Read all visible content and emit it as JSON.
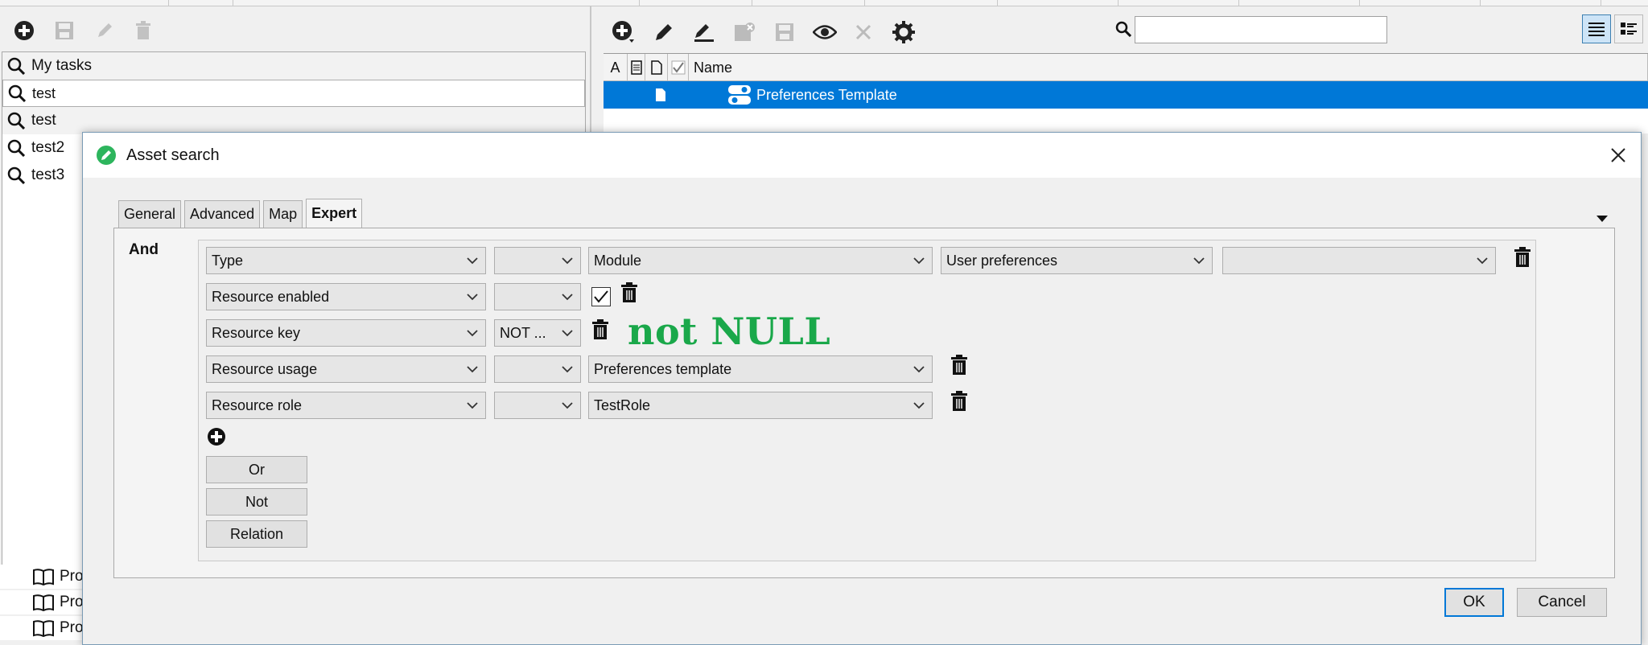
{
  "left_panel": {
    "items": [
      {
        "label": "My tasks"
      },
      {
        "label": "test"
      },
      {
        "label": "test"
      },
      {
        "label": "test2"
      },
      {
        "label": "test3"
      }
    ],
    "bottom_items": [
      {
        "label": "Pro"
      },
      {
        "label": "Pro"
      },
      {
        "label": "Pro"
      }
    ]
  },
  "right_panel": {
    "search_placeholder": "",
    "columns": [
      "A",
      "",
      "",
      "",
      "Name"
    ],
    "rows": [
      {
        "name": "Preferences Template"
      }
    ]
  },
  "dialog": {
    "title": "Asset search",
    "tabs": [
      "General",
      "Advanced",
      "Map",
      "Expert"
    ],
    "active_tab": "Expert",
    "operator_label": "And",
    "conditions": [
      {
        "field": "Type",
        "operator": "",
        "value1": "Module",
        "value2": "User preferences",
        "value3": ""
      },
      {
        "field": "Resource enabled",
        "operator": "",
        "checked": true
      },
      {
        "field": "Resource key",
        "operator": "NOT ..."
      },
      {
        "field": "Resource usage",
        "operator": "",
        "value1": "Preferences template"
      },
      {
        "field": "Resource role",
        "operator": "",
        "value1": "TestRole"
      }
    ],
    "buttons": {
      "or": "Or",
      "not": "Not",
      "relation": "Relation"
    },
    "ok": "OK",
    "cancel": "Cancel"
  },
  "annotation": "not NULL",
  "colors": {
    "selection": "#0078d7",
    "annotation": "#1aa84a"
  }
}
